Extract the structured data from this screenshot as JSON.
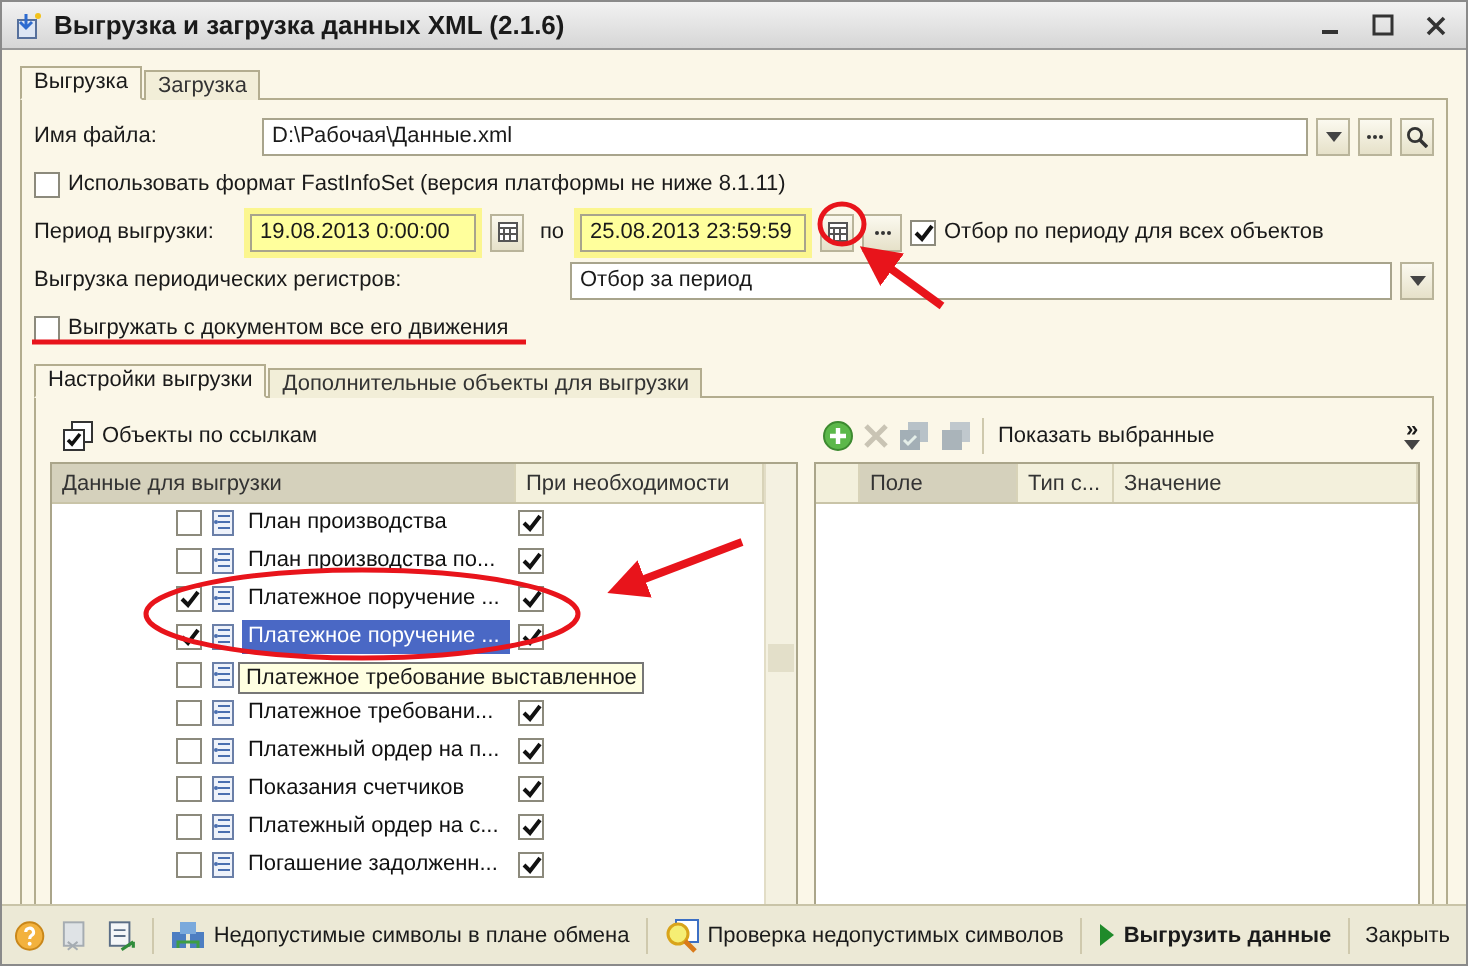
{
  "window": {
    "title": "Выгрузка и загрузка данных XML (2.1.6)"
  },
  "tabs": [
    {
      "label": "Выгрузка",
      "selected": true
    },
    {
      "label": "Загрузка",
      "selected": false
    }
  ],
  "file": {
    "label": "Имя файла:",
    "value": "D:\\Рабочая\\Данные.xml"
  },
  "fast_info_set": {
    "label": "Использовать формат FastInfoSet (версия платформы не ниже 8.1.11)",
    "checked": false
  },
  "period": {
    "label": "Период выгрузки:",
    "from": "19.08.2013  0:00:00",
    "separator": "по",
    "to": "25.08.2013 23:59:59",
    "filter_all": {
      "label": "Отбор по периоду для всех объектов",
      "checked": true
    }
  },
  "periodic_registers": {
    "label": "Выгрузка периодических регистров:",
    "value": "Отбор за период"
  },
  "with_movements": {
    "label": "Выгружать с документом все его движения",
    "checked": false
  },
  "inner_tabs": [
    {
      "label": "Настройки выгрузки",
      "selected": true
    },
    {
      "label": "Дополнительные объекты для выгрузки",
      "selected": false
    }
  ],
  "refs_button": {
    "label": "Объекты по ссылкам"
  },
  "data_table": {
    "columns": [
      "Данные для выгрузки",
      "При необходимости"
    ],
    "rows": [
      {
        "label": "План производства",
        "checked": false,
        "if_needed": true,
        "selected": false
      },
      {
        "label": "План производства по...",
        "checked": false,
        "if_needed": true,
        "selected": false
      },
      {
        "label": "Платежное поручение ...",
        "checked": true,
        "if_needed": true,
        "selected": false
      },
      {
        "label": "Платежное поручение ...",
        "checked": true,
        "if_needed": true,
        "selected": true
      },
      {
        "checked": false
      },
      {
        "label": "Платежное требовани...",
        "checked": false,
        "if_needed": true,
        "selected": false
      },
      {
        "label": "Платежный ордер на п...",
        "checked": false,
        "if_needed": true,
        "selected": false
      },
      {
        "label": "Показания счетчиков",
        "checked": false,
        "if_needed": true,
        "selected": false
      },
      {
        "label": "Платежный ордер на с...",
        "checked": false,
        "if_needed": true,
        "selected": false
      },
      {
        "label": "Погашение задолженн...",
        "checked": false,
        "if_needed": true,
        "selected": false
      }
    ]
  },
  "tooltip": "Платежное требование выставленное",
  "right_toolbar": {
    "show_selected": "Показать выбранные",
    "more": "»"
  },
  "filter_table": {
    "columns": [
      "Поле",
      "Тип с...",
      "Значение"
    ]
  },
  "footer": {
    "tools": [
      "Недопустимые символы в плане обмена",
      "Проверка недопустимых символов"
    ],
    "export": "Выгрузить данные",
    "close": "Закрыть"
  }
}
